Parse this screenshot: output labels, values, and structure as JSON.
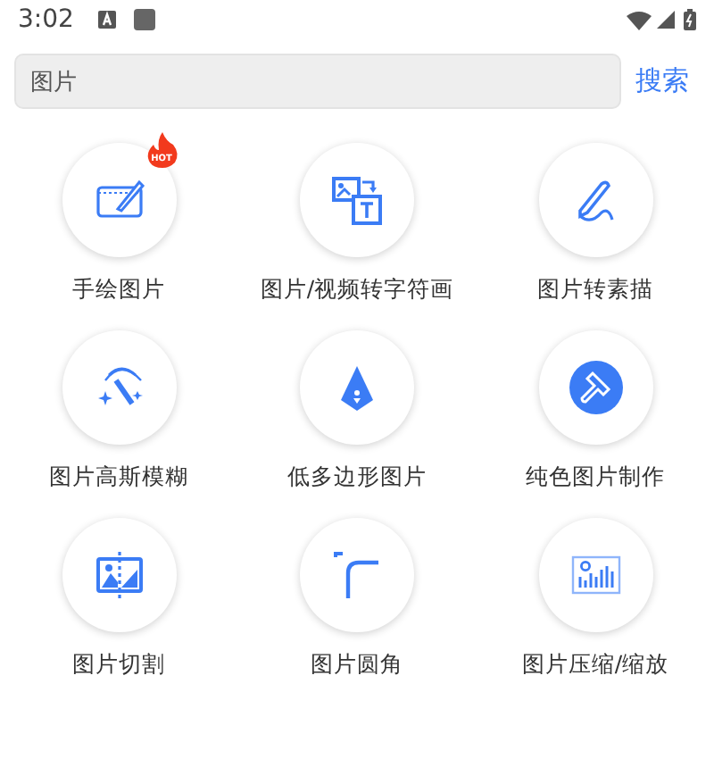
{
  "status_bar": {
    "time": "3:02"
  },
  "search": {
    "value": "图片",
    "button": "搜索"
  },
  "tools": [
    {
      "label": "手绘图片",
      "badge": "HOT"
    },
    {
      "label": "图片/视频转字符画"
    },
    {
      "label": "图片转素描"
    },
    {
      "label": "图片高斯模糊"
    },
    {
      "label": "低多边形图片"
    },
    {
      "label": "纯色图片制作"
    },
    {
      "label": "图片切割"
    },
    {
      "label": "图片圆角"
    },
    {
      "label": "图片压缩/缩放"
    }
  ]
}
